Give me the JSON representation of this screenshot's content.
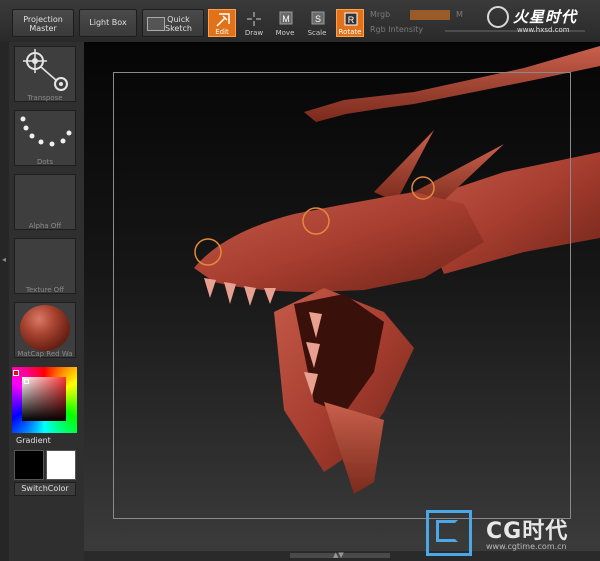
{
  "toolbar": {
    "projection_master_line1": "Projection",
    "projection_master_line2": "Master",
    "light_box": "Light Box",
    "quick_sketch_line1": "Quick",
    "quick_sketch_line2": "Sketch",
    "tools": [
      {
        "label": "Edit",
        "active": true
      },
      {
        "label": "Draw",
        "active": false
      },
      {
        "label": "Move",
        "active": false
      },
      {
        "label": "Scale",
        "active": false
      },
      {
        "label": "Rotate",
        "active": true
      }
    ],
    "mrgb": "Mrgb",
    "m": "M",
    "rgb_intensity": "Rgb Intensity",
    "accent_color": "#e2721a"
  },
  "logo_top": {
    "text": "火星时代",
    "url": "www.hxsd.com"
  },
  "shelf": {
    "transpose": "Transpose",
    "dots": "Dots",
    "alpha": "Alpha Off",
    "texture": "Texture Off",
    "matcap": "MatCap Red Wa",
    "gradient": "Gradient",
    "switch_color": "SwitchColor",
    "main_color": "#000000",
    "secondary_color": "#ffffff"
  },
  "watermark": {
    "text": "CG时代",
    "url": "www.cgtime.com.cn"
  },
  "canvas": {
    "model": "dragon-head-sculpt",
    "model_color": "#b0473a"
  }
}
